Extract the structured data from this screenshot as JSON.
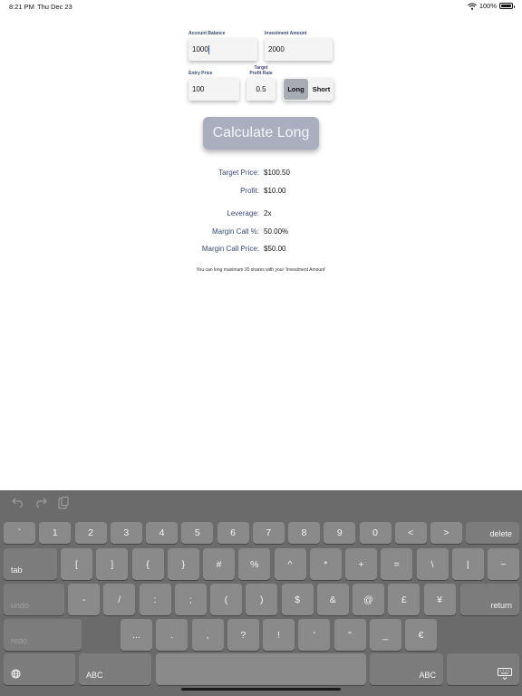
{
  "status_bar": {
    "time": "8:21 PM",
    "date": "Thu Dec 23",
    "battery": "100%"
  },
  "form": {
    "account_balance": {
      "label": "Account Balance",
      "value": "1000"
    },
    "investment_amount": {
      "label": "Investment Amount",
      "value": "2000"
    },
    "entry_price": {
      "label": "Entry Price",
      "value": "100"
    },
    "target_profit_rate": {
      "label_line1": "Target",
      "label_line2": "Profit Rate",
      "value": "0.5"
    },
    "position": {
      "options": [
        "Long",
        "Short"
      ],
      "selected": "Long"
    }
  },
  "calculate_button": "Calculate Long",
  "results": {
    "target_price": {
      "label": "Target Price:",
      "value": "$100.50"
    },
    "profit": {
      "label": "Profit:",
      "value": "$10.00"
    },
    "leverage": {
      "label": "Leverage:",
      "value": "2x"
    },
    "margin_call_pct": {
      "label": "Margin Call %:",
      "value": "50.00%"
    },
    "margin_call_price": {
      "label": "Margin Call Price:",
      "value": "$50.00"
    }
  },
  "note": "You can long maximum 20 shares with your 'Investment Amount'",
  "keyboard": {
    "toolbar_icons": [
      "undo-icon",
      "redo-icon",
      "paste-icon"
    ],
    "row1": [
      "`",
      "1",
      "2",
      "3",
      "4",
      "5",
      "6",
      "7",
      "8",
      "9",
      "0",
      "<",
      ">"
    ],
    "delete": "delete",
    "tab": "tab",
    "row2": [
      "[",
      "]",
      "{",
      "}",
      "#",
      "%",
      "^",
      "*",
      "+",
      "=",
      "\\",
      "|",
      "~"
    ],
    "undo": "undo",
    "row3": [
      "-",
      "/",
      ":",
      ";",
      "(",
      ")",
      "$",
      "&",
      "@",
      "£",
      "¥"
    ],
    "return": "return",
    "redo": "redo",
    "row4": [
      "...",
      ".",
      ",",
      "?",
      "!",
      "'",
      "\"",
      "_",
      "€"
    ],
    "abc_left": "ABC",
    "abc_right": "ABC",
    "globe_icon": "globe-icon",
    "dismiss_icon": "keyboard-dismiss-icon"
  }
}
